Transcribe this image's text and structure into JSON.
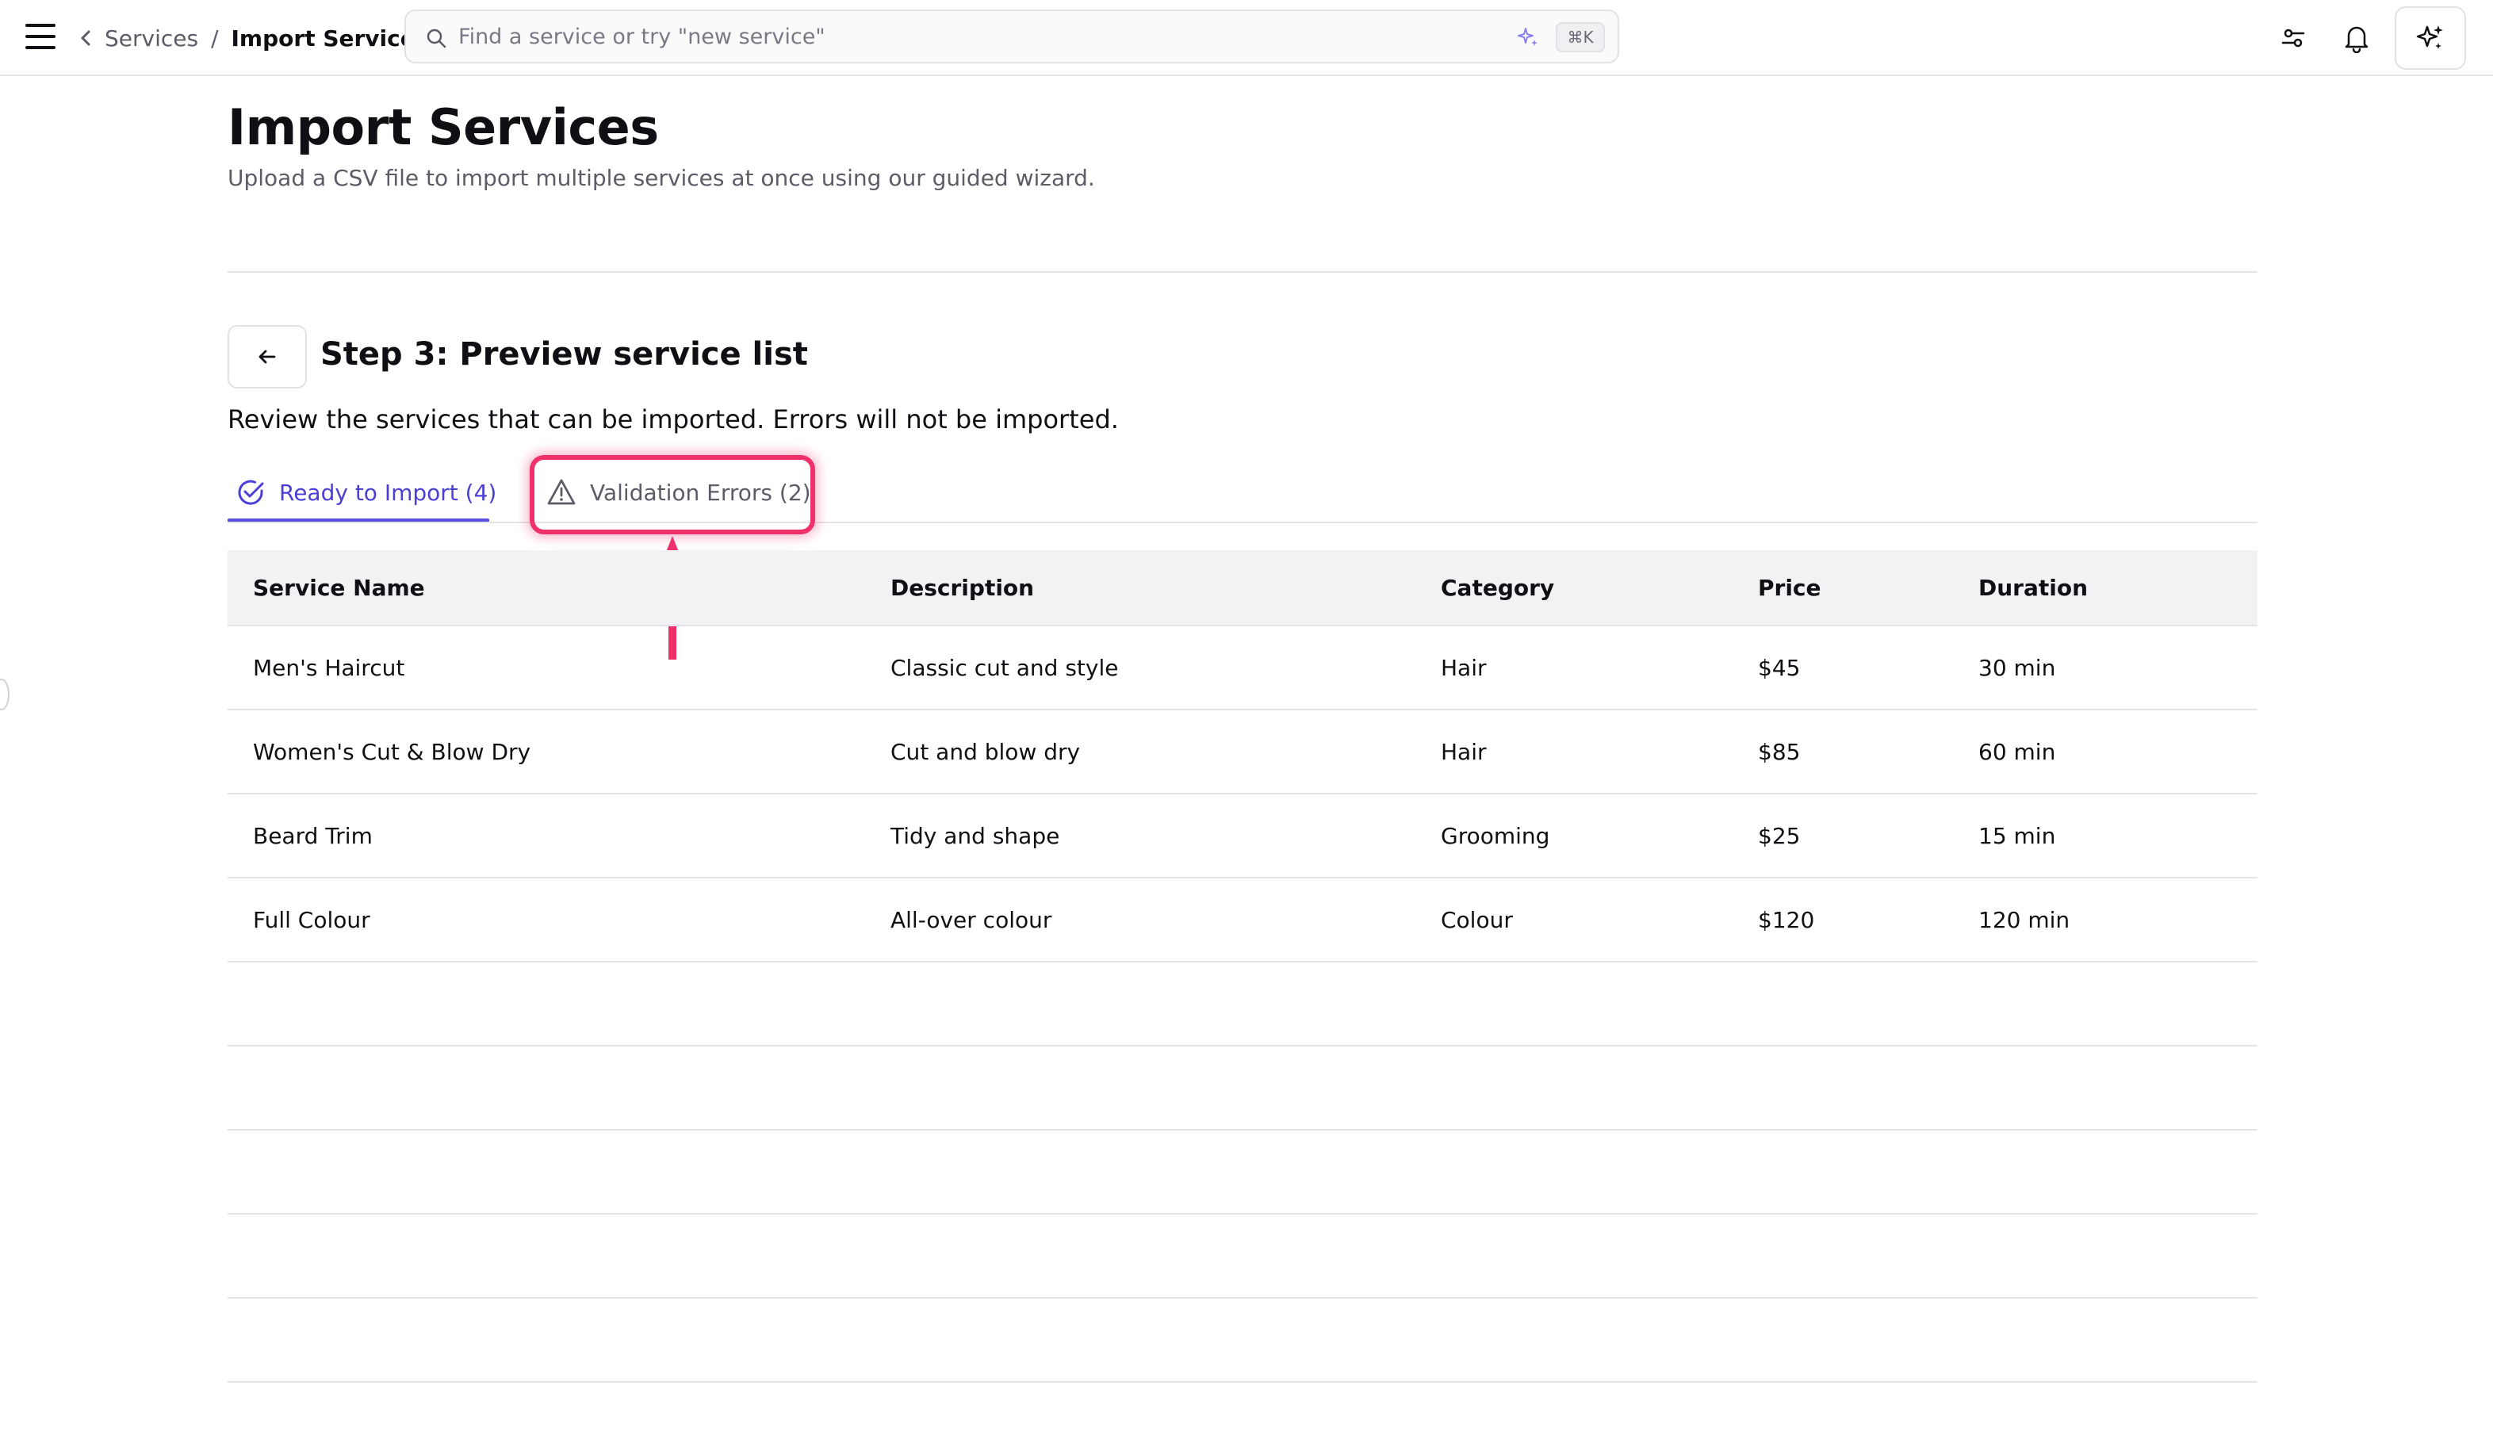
{
  "breadcrumb": {
    "parent": "Services",
    "separator": "/",
    "current": "Import Services"
  },
  "search": {
    "placeholder": "Find a service or try \"new service\"",
    "shortcut": "⌘K"
  },
  "icons": {
    "menu": "hamburger-icon",
    "back_chevron": "chevron-left-icon",
    "search": "search-icon",
    "sparkle": "sparkle-icon",
    "filters": "sliders-icon",
    "notifications": "bell-icon",
    "ai": "sparkle-icon",
    "step_back": "arrow-left-icon",
    "ready": "check-circle-icon",
    "errors": "warning-triangle-icon"
  },
  "header": {
    "title": "Import Services",
    "subtitle": "Upload a CSV file to import multiple services at once using our guided wizard."
  },
  "step": {
    "title": "Step 3: Preview service list",
    "description": "Review the services that can be imported. Errors will not be imported."
  },
  "tabs": [
    {
      "label": "Ready to Import (4)",
      "active": true
    },
    {
      "label": "Validation Errors (2)",
      "active": false
    }
  ],
  "table": {
    "columns": [
      "Service Name",
      "Description",
      "Category",
      "Price",
      "Duration"
    ],
    "rows": [
      [
        "Men's Haircut",
        "Classic cut and style",
        "Hair",
        "$45",
        "30 min"
      ],
      [
        "Women's Cut & Blow Dry",
        "Cut and blow dry",
        "Hair",
        "$85",
        "60 min"
      ],
      [
        "Beard Trim",
        "Tidy and shape",
        "Grooming",
        "$25",
        "15 min"
      ],
      [
        "Full Colour",
        "All-over colour",
        "Colour",
        "$120",
        "120 min"
      ],
      [
        "",
        "",
        "",
        "",
        ""
      ],
      [
        "",
        "",
        "",
        "",
        ""
      ],
      [
        "",
        "",
        "",
        "",
        ""
      ],
      [
        "",
        "",
        "",
        "",
        ""
      ],
      [
        "",
        "",
        "",
        "",
        ""
      ]
    ]
  },
  "colors": {
    "accent": "#5a4fe0",
    "annotation": "#f0306a",
    "header_bg": "#f2f2f4",
    "border": "#e4e4e8"
  }
}
